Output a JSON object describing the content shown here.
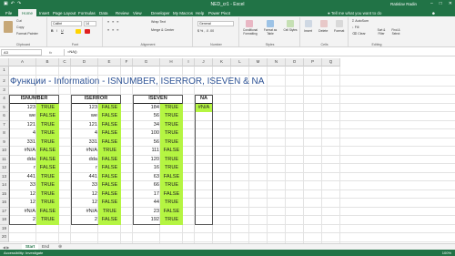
{
  "window": {
    "title": "NED_cr1 - Excel",
    "user": "Ratislav Radin",
    "accent": "#217346"
  },
  "ribbon": {
    "tabs": [
      "File",
      "Home",
      "Insert",
      "Page Layout",
      "Formulas",
      "Data",
      "Review",
      "View",
      "Developer",
      "My Macros",
      "Help",
      "Power Pivot"
    ],
    "active_tab": "Home",
    "tell_me": "Tell me what you want to do",
    "clipboard": {
      "cut": "Cut",
      "copy": "Copy",
      "format_painter": "Format Painter",
      "label": "Clipboard"
    },
    "font": {
      "name": "Calibri",
      "size": "14",
      "label": "Font"
    },
    "alignment": {
      "wrap": "Wrap Text",
      "merge": "Merge & Center",
      "label": "Alignment"
    },
    "number": {
      "format": "General",
      "label": "Number"
    },
    "styles": {
      "conditional": "Conditional Formatting",
      "format_as_table": "Format as Table",
      "cell_styles": "Cell Styles",
      "label": "Styles"
    },
    "cells": {
      "insert": "Insert",
      "delete": "Delete",
      "format": "Format",
      "label": "Cells"
    },
    "editing": {
      "autosum": "AutoSum",
      "fill": "Fill",
      "clear": "Clear",
      "sort": "Sort & Filter",
      "find": "Find & Select",
      "label": "Editing"
    }
  },
  "formula_bar": {
    "name_box": "A3",
    "fx": "fx",
    "formula": "=NA()"
  },
  "sheet": {
    "columns": [
      "A",
      "B",
      "C",
      "D",
      "E",
      "F",
      "G",
      "H",
      "I",
      "J",
      "K",
      "L",
      "M",
      "N",
      "O",
      "P",
      "Q"
    ],
    "rows": [
      "1",
      "2",
      "3",
      "4",
      "5",
      "6",
      "7",
      "8",
      "9",
      "10",
      "11",
      "12",
      "13",
      "14",
      "15",
      "16",
      "17",
      "18",
      "19",
      "20"
    ],
    "title": "Функции - Information - ISNUMBER, ISERROR, ISEVEN & NA",
    "headers": {
      "isnumber": "ISNUMBER",
      "iserror": "ISERROR",
      "iseven": "ISEVEN",
      "na": "NA"
    },
    "na_value": "#N/A",
    "isnumber": [
      [
        "123",
        "TRUE"
      ],
      [
        "we",
        "FALSE"
      ],
      [
        "121",
        "TRUE"
      ],
      [
        "4",
        "TRUE"
      ],
      [
        "331",
        "TRUE"
      ],
      [
        "#N/A",
        "FALSE"
      ],
      [
        "dda",
        "FALSE"
      ],
      [
        "r",
        "FALSE"
      ],
      [
        "441",
        "TRUE"
      ],
      [
        "33",
        "TRUE"
      ],
      [
        "12",
        "TRUE"
      ],
      [
        "12",
        "TRUE"
      ],
      [
        "#N/A",
        "FALSE"
      ],
      [
        "2",
        "TRUE"
      ]
    ],
    "iserror": [
      [
        "123",
        "FALSE"
      ],
      [
        "we",
        "FALSE"
      ],
      [
        "121",
        "FALSE"
      ],
      [
        "4",
        "FALSE"
      ],
      [
        "331",
        "FALSE"
      ],
      [
        "#N/A",
        "TRUE"
      ],
      [
        "dda",
        "FALSE"
      ],
      [
        "r",
        "FALSE"
      ],
      [
        "441",
        "FALSE"
      ],
      [
        "33",
        "FALSE"
      ],
      [
        "12",
        "FALSE"
      ],
      [
        "12",
        "FALSE"
      ],
      [
        "#N/A",
        "TRUE"
      ],
      [
        "2",
        "FALSE"
      ]
    ],
    "iseven": [
      [
        "184",
        "TRUE"
      ],
      [
        "56",
        "TRUE"
      ],
      [
        "34",
        "TRUE"
      ],
      [
        "100",
        "TRUE"
      ],
      [
        "56",
        "TRUE"
      ],
      [
        "111",
        "FALSE"
      ],
      [
        "120",
        "TRUE"
      ],
      [
        "16",
        "TRUE"
      ],
      [
        "63",
        "FALSE"
      ],
      [
        "66",
        "TRUE"
      ],
      [
        "17",
        "FALSE"
      ],
      [
        "44",
        "TRUE"
      ],
      [
        "23",
        "FALSE"
      ],
      [
        "192",
        "TRUE"
      ]
    ]
  },
  "sheet_tabs": [
    "Start",
    "End"
  ],
  "active_sheet": "Start",
  "status": {
    "text": "Accessibility: Investigate",
    "zoom": "100%"
  }
}
